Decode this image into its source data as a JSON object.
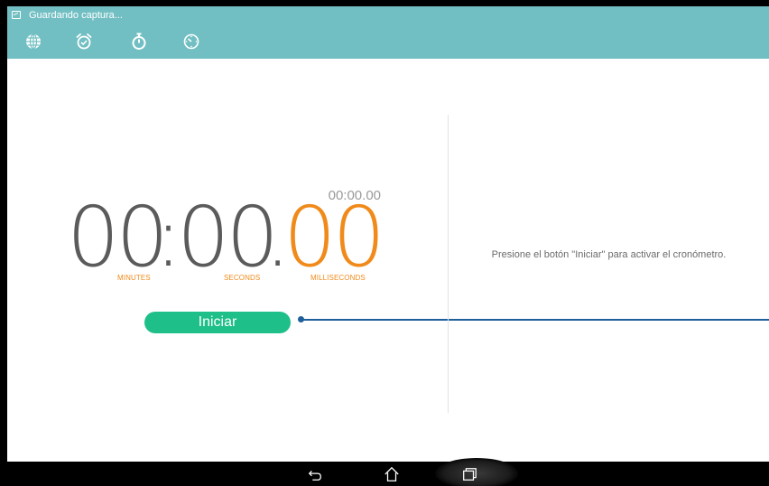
{
  "status_bar": {
    "notification_text": "Guardando captura...",
    "icon": "screenshot-icon"
  },
  "tabs": [
    {
      "name": "world-clock-tab",
      "icon": "globe-icon"
    },
    {
      "name": "alarm-tab",
      "icon": "alarm-clock-icon"
    },
    {
      "name": "stopwatch-tab",
      "icon": "stopwatch-icon",
      "selected": true
    },
    {
      "name": "timer-tab",
      "icon": "timer-icon"
    }
  ],
  "stopwatch": {
    "lap_time": "00:00.00",
    "minutes": "00",
    "colon": ":",
    "seconds": "00",
    "dot": ".",
    "milliseconds": "00",
    "minutes_label": "MINUTES",
    "seconds_label": "SECONDS",
    "milliseconds_label": "MILLISECONDS",
    "start_label": "Iniciar"
  },
  "side_panel": {
    "hint": "Presione el botón \"Iniciar\" para activar el cronómetro."
  },
  "nav_bar": {
    "buttons": [
      "back-icon",
      "home-icon",
      "recent-apps-icon"
    ]
  },
  "colors": {
    "header": "#72bfc3",
    "accent_orange": "#f08a1a",
    "start_button": "#1fbf8a",
    "annotation": "#1f5f9a"
  }
}
